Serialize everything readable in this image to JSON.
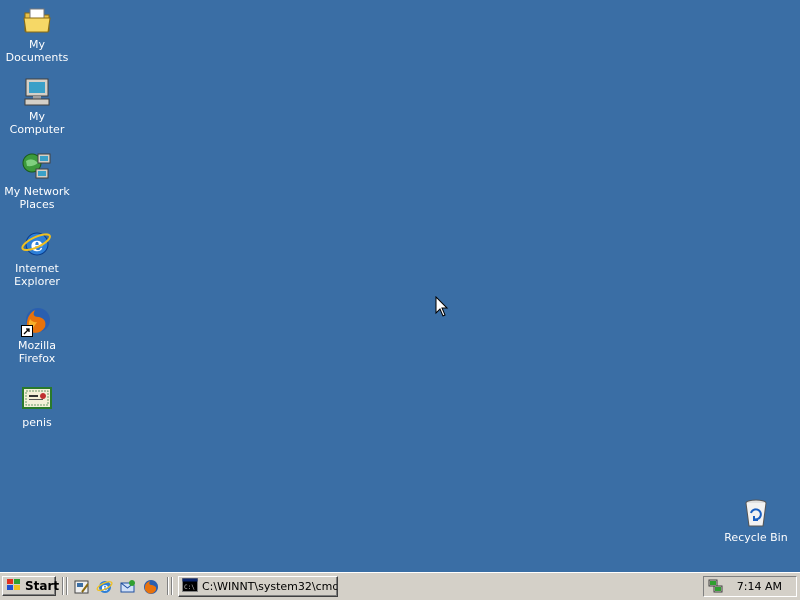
{
  "desktop": {
    "background_color": "#3a6ea5",
    "icons": [
      {
        "label": "My Documents",
        "icon": "folder-documents-icon"
      },
      {
        "label": "My Computer",
        "icon": "computer-icon"
      },
      {
        "label": "My Network Places",
        "icon": "network-places-icon"
      },
      {
        "label": "Internet Explorer",
        "icon": "internet-explorer-icon"
      },
      {
        "label": "Mozilla Firefox",
        "icon": "firefox-icon"
      },
      {
        "label": "penis",
        "icon": "certificate-icon"
      },
      {
        "label": "Recycle Bin",
        "icon": "recycle-bin-icon"
      }
    ]
  },
  "taskbar": {
    "start_label": "Start",
    "quick_launch": [
      {
        "icon": "show-desktop-icon"
      },
      {
        "icon": "internet-explorer-icon"
      },
      {
        "icon": "outlook-express-icon"
      },
      {
        "icon": "firefox-icon"
      }
    ],
    "tasks": [
      {
        "label": "C:\\WINNT\\system32\\cmd...",
        "icon": "command-prompt-icon"
      }
    ],
    "tray": {
      "clock": "7:14 AM",
      "icons": [
        {
          "icon": "network-connection-icon"
        }
      ]
    }
  }
}
